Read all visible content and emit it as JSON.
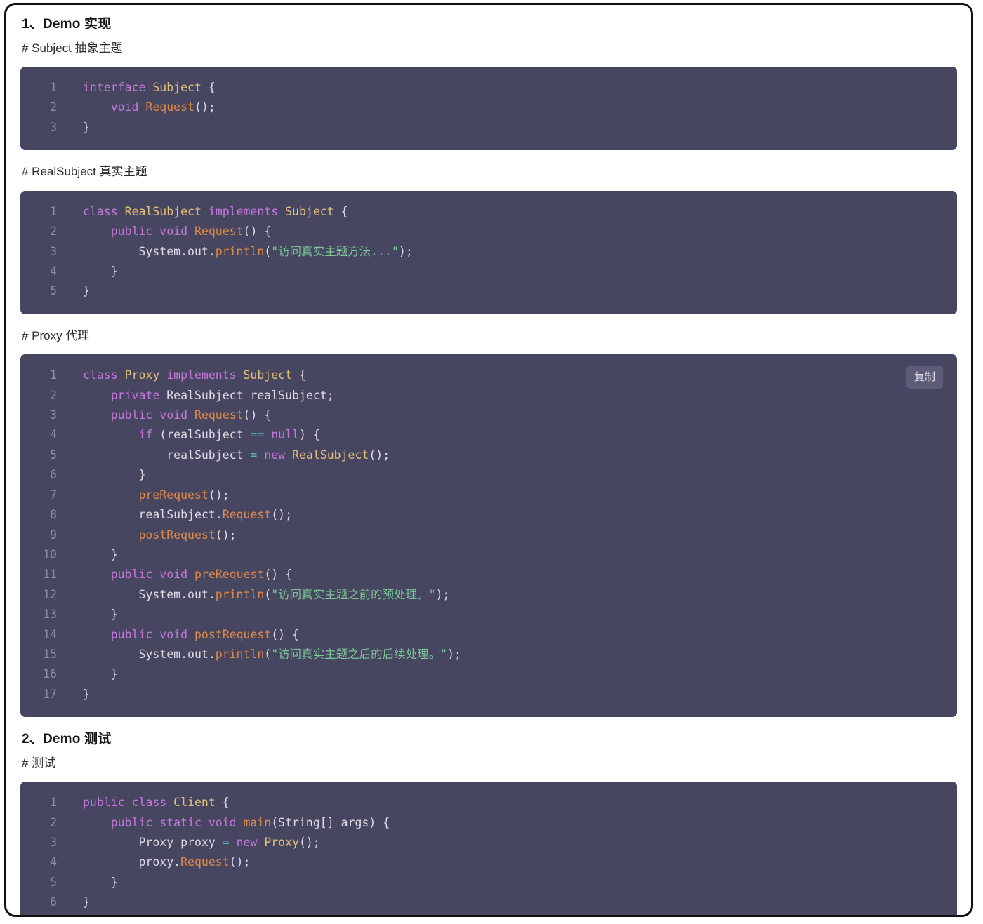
{
  "page": {
    "sections": [
      {
        "title": "1、Demo 实现",
        "blocks": [
          {
            "label": "# Subject 抽象主题",
            "copy_label": null,
            "lines": [
              [
                {
                  "t": "interface ",
                  "c": "kw"
                },
                {
                  "t": "Subject ",
                  "c": "typ"
                },
                {
                  "t": "{",
                  "c": "pln"
                }
              ],
              [
                {
                  "t": "    ",
                  "c": "pln"
                },
                {
                  "t": "void ",
                  "c": "kw"
                },
                {
                  "t": "Request",
                  "c": "fn"
                },
                {
                  "t": "();",
                  "c": "pln"
                }
              ],
              [
                {
                  "t": "}",
                  "c": "pln"
                }
              ]
            ]
          },
          {
            "label": "# RealSubject 真实主题",
            "copy_label": null,
            "lines": [
              [
                {
                  "t": "class ",
                  "c": "kw"
                },
                {
                  "t": "RealSubject ",
                  "c": "typ"
                },
                {
                  "t": "implements ",
                  "c": "kw"
                },
                {
                  "t": "Subject ",
                  "c": "typ"
                },
                {
                  "t": "{",
                  "c": "pln"
                }
              ],
              [
                {
                  "t": "    ",
                  "c": "pln"
                },
                {
                  "t": "public void ",
                  "c": "kw"
                },
                {
                  "t": "Request",
                  "c": "fn"
                },
                {
                  "t": "() {",
                  "c": "pln"
                }
              ],
              [
                {
                  "t": "        System.out.",
                  "c": "pln"
                },
                {
                  "t": "println",
                  "c": "fn"
                },
                {
                  "t": "(",
                  "c": "pln"
                },
                {
                  "t": "\"访问真实主题方法...\"",
                  "c": "str"
                },
                {
                  "t": ");",
                  "c": "pln"
                }
              ],
              [
                {
                  "t": "    }",
                  "c": "pln"
                }
              ],
              [
                {
                  "t": "}",
                  "c": "pln"
                }
              ]
            ]
          },
          {
            "label": "# Proxy 代理",
            "copy_label": "复制",
            "lines": [
              [
                {
                  "t": "class ",
                  "c": "kw"
                },
                {
                  "t": "Proxy ",
                  "c": "typ"
                },
                {
                  "t": "implements ",
                  "c": "kw"
                },
                {
                  "t": "Subject ",
                  "c": "typ"
                },
                {
                  "t": "{",
                  "c": "pln"
                }
              ],
              [
                {
                  "t": "    ",
                  "c": "pln"
                },
                {
                  "t": "private ",
                  "c": "kw"
                },
                {
                  "t": "RealSubject realSubject;",
                  "c": "pln"
                }
              ],
              [
                {
                  "t": "    ",
                  "c": "pln"
                },
                {
                  "t": "public void ",
                  "c": "kw"
                },
                {
                  "t": "Request",
                  "c": "fn"
                },
                {
                  "t": "() {",
                  "c": "pln"
                }
              ],
              [
                {
                  "t": "        ",
                  "c": "pln"
                },
                {
                  "t": "if ",
                  "c": "kw"
                },
                {
                  "t": "(realSubject ",
                  "c": "pln"
                },
                {
                  "t": "==",
                  "c": "op"
                },
                {
                  "t": " ",
                  "c": "pln"
                },
                {
                  "t": "null",
                  "c": "kw"
                },
                {
                  "t": ") {",
                  "c": "pln"
                }
              ],
              [
                {
                  "t": "            realSubject ",
                  "c": "pln"
                },
                {
                  "t": "=",
                  "c": "op"
                },
                {
                  "t": " ",
                  "c": "pln"
                },
                {
                  "t": "new ",
                  "c": "kw"
                },
                {
                  "t": "RealSubject",
                  "c": "typ"
                },
                {
                  "t": "();",
                  "c": "pln"
                }
              ],
              [
                {
                  "t": "        }",
                  "c": "pln"
                }
              ],
              [
                {
                  "t": "        ",
                  "c": "pln"
                },
                {
                  "t": "preRequest",
                  "c": "fn"
                },
                {
                  "t": "();",
                  "c": "pln"
                }
              ],
              [
                {
                  "t": "        realSubject.",
                  "c": "pln"
                },
                {
                  "t": "Request",
                  "c": "fn"
                },
                {
                  "t": "();",
                  "c": "pln"
                }
              ],
              [
                {
                  "t": "        ",
                  "c": "pln"
                },
                {
                  "t": "postRequest",
                  "c": "fn"
                },
                {
                  "t": "();",
                  "c": "pln"
                }
              ],
              [
                {
                  "t": "    }",
                  "c": "pln"
                }
              ],
              [
                {
                  "t": "    ",
                  "c": "pln"
                },
                {
                  "t": "public void ",
                  "c": "kw"
                },
                {
                  "t": "preRequest",
                  "c": "fn"
                },
                {
                  "t": "() {",
                  "c": "pln"
                }
              ],
              [
                {
                  "t": "        System.out.",
                  "c": "pln"
                },
                {
                  "t": "println",
                  "c": "fn"
                },
                {
                  "t": "(",
                  "c": "pln"
                },
                {
                  "t": "\"访问真实主题之前的预处理。\"",
                  "c": "str"
                },
                {
                  "t": ");",
                  "c": "pln"
                }
              ],
              [
                {
                  "t": "    }",
                  "c": "pln"
                }
              ],
              [
                {
                  "t": "    ",
                  "c": "pln"
                },
                {
                  "t": "public void ",
                  "c": "kw"
                },
                {
                  "t": "postRequest",
                  "c": "fn"
                },
                {
                  "t": "() {",
                  "c": "pln"
                }
              ],
              [
                {
                  "t": "        System.out.",
                  "c": "pln"
                },
                {
                  "t": "println",
                  "c": "fn"
                },
                {
                  "t": "(",
                  "c": "pln"
                },
                {
                  "t": "\"访问真实主题之后的后续处理。\"",
                  "c": "str"
                },
                {
                  "t": ");",
                  "c": "pln"
                }
              ],
              [
                {
                  "t": "    }",
                  "c": "pln"
                }
              ],
              [
                {
                  "t": "}",
                  "c": "pln"
                }
              ]
            ]
          }
        ]
      },
      {
        "title": "2、Demo 测试",
        "blocks": [
          {
            "label": "# 测试",
            "copy_label": null,
            "lines": [
              [
                {
                  "t": "public class ",
                  "c": "kw"
                },
                {
                  "t": "Client ",
                  "c": "typ"
                },
                {
                  "t": "{",
                  "c": "pln"
                }
              ],
              [
                {
                  "t": "    ",
                  "c": "pln"
                },
                {
                  "t": "public static void ",
                  "c": "kw"
                },
                {
                  "t": "main",
                  "c": "fn"
                },
                {
                  "t": "(String[] args) {",
                  "c": "pln"
                }
              ],
              [
                {
                  "t": "        Proxy proxy ",
                  "c": "pln"
                },
                {
                  "t": "=",
                  "c": "op"
                },
                {
                  "t": " ",
                  "c": "pln"
                },
                {
                  "t": "new ",
                  "c": "kw"
                },
                {
                  "t": "Proxy",
                  "c": "typ"
                },
                {
                  "t": "();",
                  "c": "pln"
                }
              ],
              [
                {
                  "t": "        proxy.",
                  "c": "pln"
                },
                {
                  "t": "Request",
                  "c": "fn"
                },
                {
                  "t": "();",
                  "c": "pln"
                }
              ],
              [
                {
                  "t": "    }",
                  "c": "pln"
                }
              ],
              [
                {
                  "t": "}",
                  "c": "pln"
                }
              ]
            ]
          }
        ]
      }
    ]
  },
  "theme": {
    "page_background": "#ffffff",
    "frame_border": "#111114",
    "code_background": "#464660",
    "gutter_text": "#8e8ea6",
    "gutter_divider": "#6a6a84",
    "code_text": "#dcdce6",
    "keyword": "#c678dd",
    "type": "#e5c07b",
    "function": "#e08a48",
    "string": "#7ec699",
    "operator": "#56b6c2",
    "copy_button_background": "#5c5c78",
    "copy_button_text": "#e8e8f2",
    "heading_text": "#16161a",
    "label_text": "#2c2c30"
  }
}
